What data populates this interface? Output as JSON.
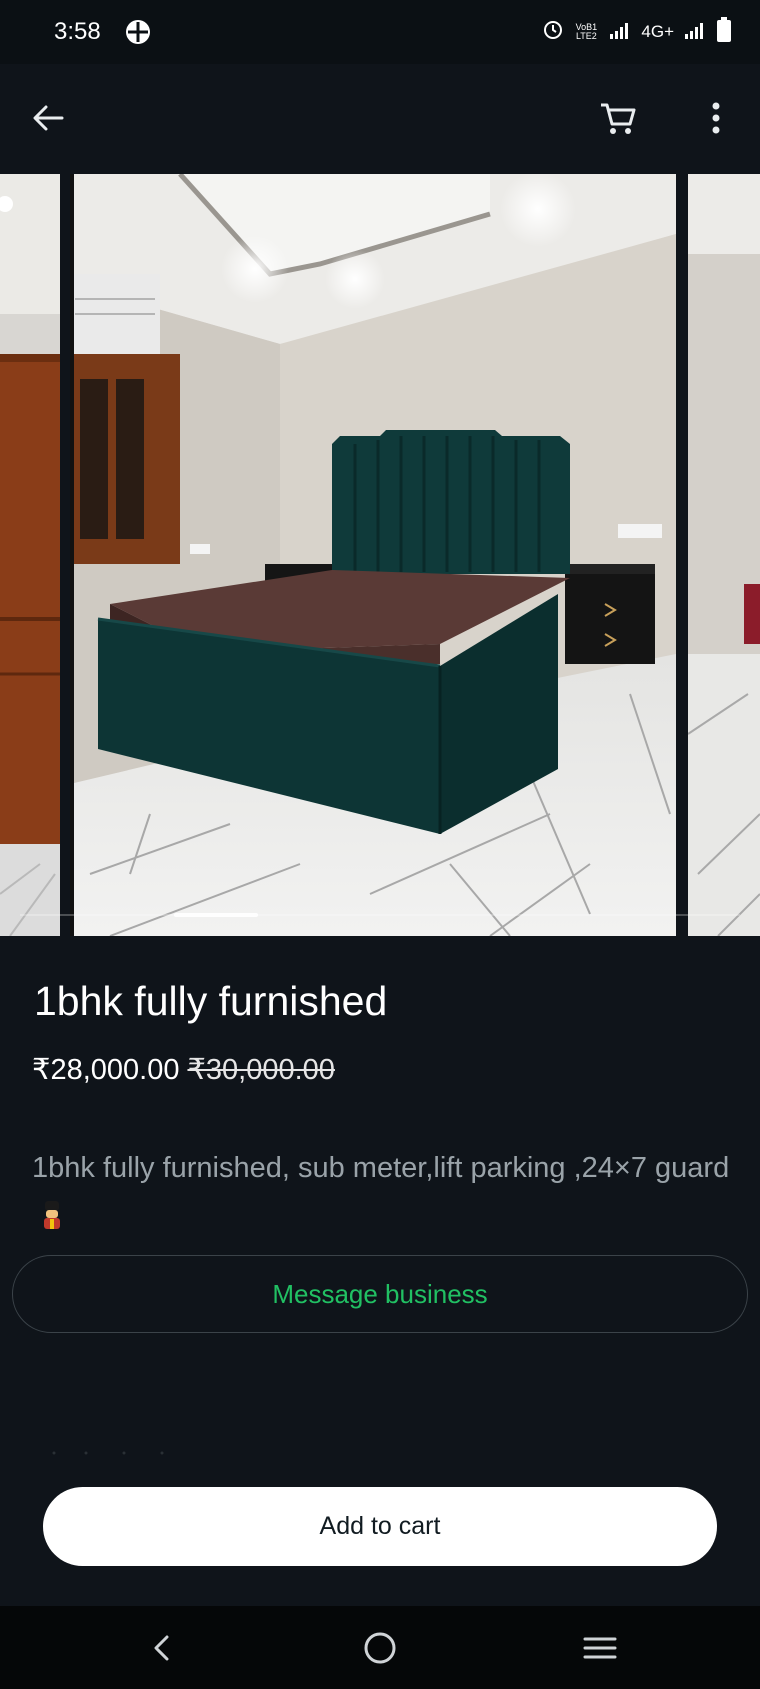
{
  "status_bar": {
    "time": "3:58",
    "volte_label": "VoB1 LTE2",
    "network_label": "4G+"
  },
  "app_bar": {
    "back_icon": "arrow-left-icon",
    "cart_icon": "shopping-cart-icon",
    "more_icon": "more-vert-icon"
  },
  "carousel": {
    "image_count": 3,
    "current_index": 1
  },
  "product": {
    "title": "1bhk fully furnished",
    "price": "₹28,000.00",
    "original_price": "₹30,000.00",
    "description": "1bhk fully furnished,  sub meter,lift  parking ,24×7 guard"
  },
  "actions": {
    "message_label": "Message business",
    "add_to_cart_label": "Add to cart"
  },
  "colors": {
    "background": "#0f141a",
    "accent_green": "#21c063",
    "primary_button_bg": "#ffffff"
  }
}
